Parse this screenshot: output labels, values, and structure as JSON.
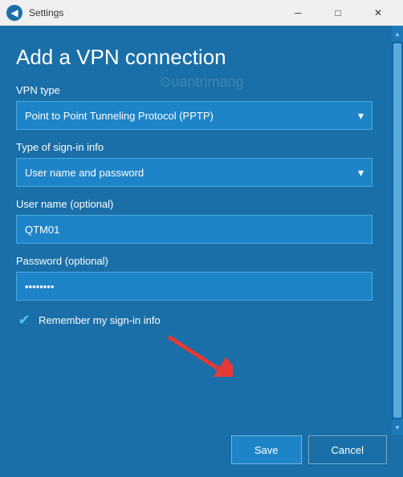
{
  "window": {
    "title": "Settings",
    "back_icon": "◀",
    "minimize_icon": "─",
    "maximize_icon": "□",
    "close_icon": "✕"
  },
  "page": {
    "title": "Add a VPN connection",
    "watermark": "⊙uantrimang"
  },
  "fields": {
    "vpn_type": {
      "label": "VPN type",
      "value": "Point to Point Tunneling Protocol (PPTP)"
    },
    "sign_in_type": {
      "label": "Type of sign-in info",
      "value": "User name and password"
    },
    "username": {
      "label": "User name (optional)",
      "value": "QTM01",
      "placeholder": ""
    },
    "password": {
      "label": "Password (optional)",
      "value": "••••••••",
      "placeholder": ""
    },
    "remember": {
      "label": "Remember my sign-in info",
      "checked": true,
      "checkmark": "✔"
    }
  },
  "buttons": {
    "save": "Save",
    "cancel": "Cancel"
  },
  "scrollbar": {
    "up": "▲",
    "down": "▼"
  }
}
